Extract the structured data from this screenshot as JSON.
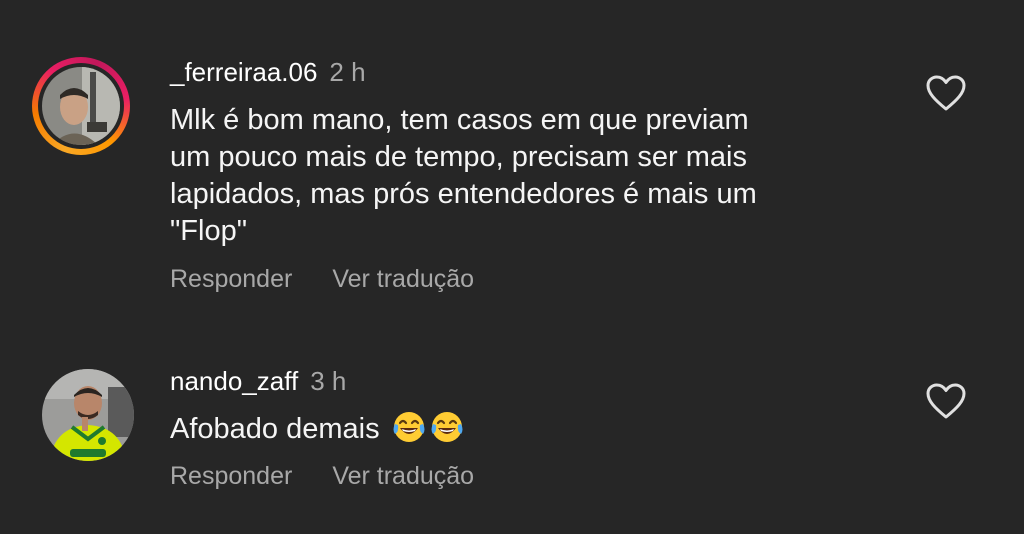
{
  "comments": [
    {
      "username": "_ferreiraa.06",
      "time": "2 h",
      "text_lines": [
        "Mlk é bom mano, tem casos em que previam",
        "um pouco mais de tempo, precisam ser mais",
        "lapidados, mas prós entendedores é mais um",
        "\"Flop\""
      ],
      "reply_label": "Responder",
      "translate_label": "Ver tradução",
      "avatar_has_story_ring": true,
      "like_icon": "heart-outline-icon"
    },
    {
      "username": "nando_zaff",
      "time": "3 h",
      "text": "Afobado demais",
      "emojis": [
        "face-with-tears-of-joy",
        "face-with-tears-of-joy"
      ],
      "reply_label": "Responder",
      "translate_label": "Ver tradução",
      "avatar_has_story_ring": false,
      "like_icon": "heart-outline-icon"
    }
  ],
  "colors": {
    "background": "#262626",
    "primary_text": "#ffffff",
    "secondary_text": "#a8a8a8"
  }
}
